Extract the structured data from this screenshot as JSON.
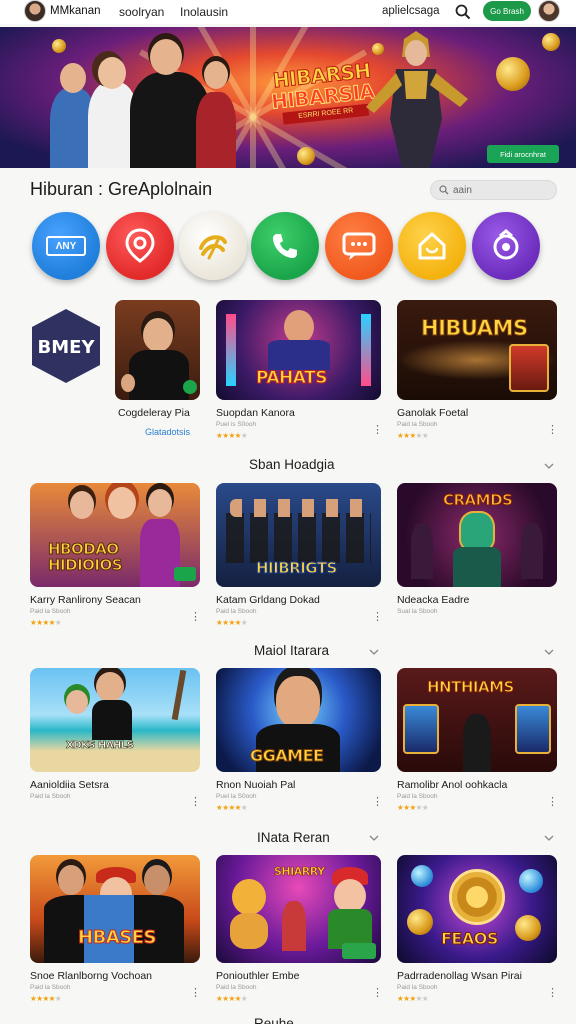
{
  "header": {
    "brand": "MMkanan",
    "nav": [
      "soolryan",
      "Inolausin",
      "aplielcsaga"
    ],
    "go_button": "Go Brash"
  },
  "banner": {
    "title_line1": "HIBARSH",
    "title_line2": "HIBARSIA",
    "title_line3": "ESRRI ROEE RR",
    "cta": "Fidi arocnhrat"
  },
  "section": {
    "title": "Hiburan : GreAplolnain",
    "search_placeholder": "aain"
  },
  "apps": [
    {
      "name": "any-app",
      "label": "ΛNY",
      "color": "#1f7fdb"
    },
    {
      "name": "pin-app",
      "color": "#e22a2a"
    },
    {
      "name": "swirl-app",
      "color": "#f3f0e8"
    },
    {
      "name": "phone-app",
      "color": "#1aa54a"
    },
    {
      "name": "chat-app",
      "color": "#f15a1f"
    },
    {
      "name": "home-app",
      "color": "#f4b20f"
    },
    {
      "name": "camera-app",
      "color": "#6c2dbd"
    }
  ],
  "first_row": {
    "badge": "BMEY",
    "cards": [
      {
        "title": "Cogdeleray Pia",
        "link": "Glatadotsis"
      },
      {
        "title": "Suopdan Kanora",
        "sub": "Puel is S0ooh",
        "rating": 4,
        "thumb_text": "PAHATS"
      },
      {
        "title": "Ganolak Foetal",
        "sub": "Paid la Sbooh",
        "rating": 3,
        "thumb_text": "HIBUAMS"
      }
    ]
  },
  "rows": [
    {
      "label": "Sban Hoadgia",
      "cards": [
        {
          "title": "Karry Ranlirony Seacan",
          "sub": "Paid la Sbooh",
          "rating": 4,
          "thumb_text": "HBODAO HIDIOIOS"
        },
        {
          "title": "Katam Grldang Dokad",
          "sub": "Paid la Sbooh",
          "rating": 4,
          "thumb_text": "HIIBRIGTS"
        },
        {
          "title": "Ndeacka Eadre",
          "sub": "Sual la Sbooh",
          "rating": 0,
          "thumb_text": "CRAMDS"
        }
      ]
    },
    {
      "label": "Maiol Itarara",
      "cards": [
        {
          "title": "Aanioldiia Setsra",
          "sub": "Paid la Sbooh",
          "rating": 0,
          "thumb_text": "XDKS HAHLS"
        },
        {
          "title": "Rnon Nuoiah Pal",
          "sub": "Puel la S0ooh",
          "rating": 4,
          "thumb_text": "GGAMEE"
        },
        {
          "title": "Ramolibr Anol oohkacla",
          "sub": "Paid la Sbooh",
          "rating": 3,
          "thumb_text": "HNTHIAMS"
        }
      ]
    },
    {
      "label": "INata Reran",
      "cards": [
        {
          "title": "Snoe Rlanlborng Vochoan",
          "sub": "Paid la Sbooh",
          "rating": 4,
          "thumb_text": "HBASES"
        },
        {
          "title": "Poniouthler Embe",
          "sub": "Paid la Sbooh",
          "rating": 4,
          "thumb_text": "SHIARRY"
        },
        {
          "title": "Padrradenollag Wsan Pirai",
          "sub": "Paid la Sbooh",
          "rating": 3,
          "thumb_text": "FEAOS"
        }
      ]
    }
  ],
  "footer_partial": "Reuhe"
}
